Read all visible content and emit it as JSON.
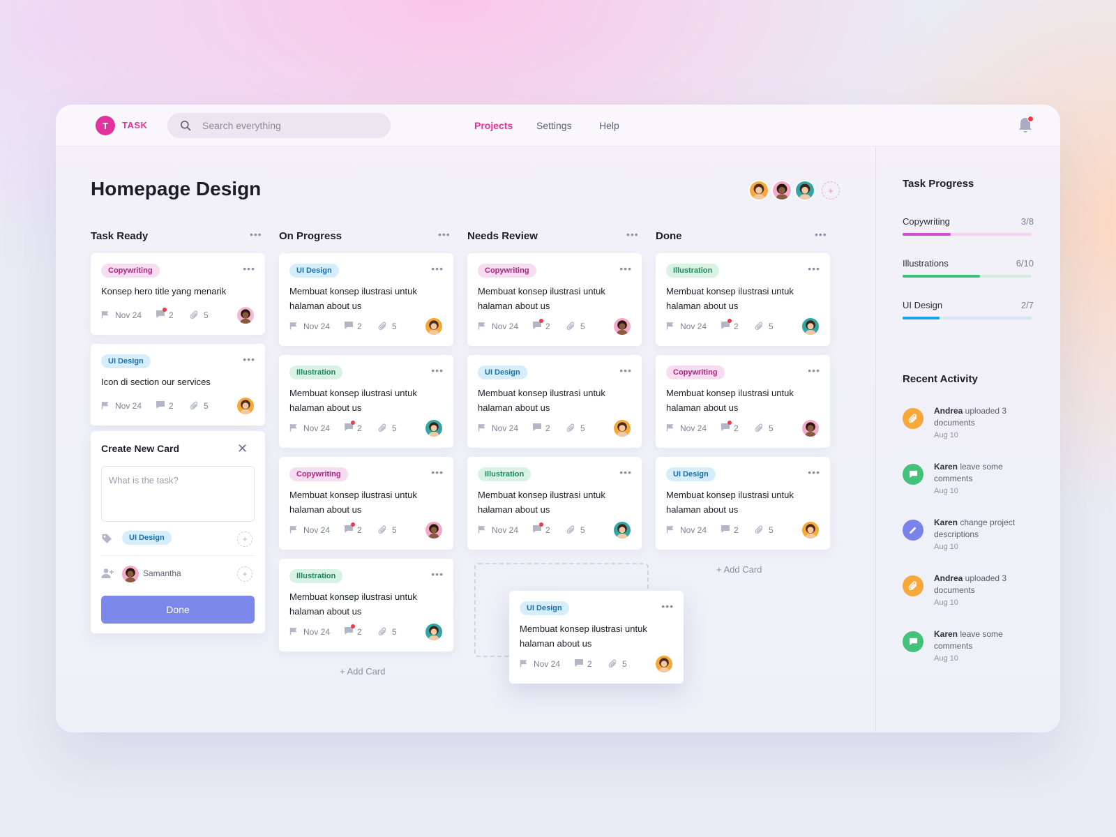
{
  "app": {
    "logo_letter": "T",
    "logo_text": "TASK"
  },
  "search": {
    "placeholder": "Search everything"
  },
  "nav": [
    {
      "label": "Projects",
      "active": true
    },
    {
      "label": "Settings"
    },
    {
      "label": "Help"
    }
  ],
  "page": {
    "title": "Homepage Design"
  },
  "board": {
    "add_card_label": "+ Add Card",
    "columns": [
      {
        "title": "Task Ready",
        "cards": [
          {
            "tag": "Copywriting",
            "title": "Konsep hero title yang menarik",
            "date": "Nov 24",
            "comments": "2",
            "attachments": "5",
            "unread": true,
            "avatar": "dark"
          },
          {
            "tag": "UI Design",
            "title": "Icon di section our services",
            "date": "Nov 24",
            "comments": "2",
            "attachments": "5",
            "unread": false,
            "avatar": "orange"
          }
        ]
      },
      {
        "title": "On Progress",
        "cards": [
          {
            "tag": "UI Design",
            "title": "Membuat konsep ilustrasi untuk halaman about us",
            "date": "Nov 24",
            "comments": "2",
            "attachments": "5",
            "unread": false,
            "avatar": "orange"
          },
          {
            "tag": "Illustration",
            "title": "Membuat konsep ilustrasi untuk halaman about us",
            "date": "Nov 24",
            "comments": "2",
            "attachments": "5",
            "unread": true,
            "avatar": "teal"
          },
          {
            "tag": "Copywriting",
            "title": "Membuat konsep ilustrasi untuk halaman about us",
            "date": "Nov 24",
            "comments": "2",
            "attachments": "5",
            "unread": true,
            "avatar": "pink"
          },
          {
            "tag": "Illustration",
            "title": "Membuat konsep ilustrasi untuk halaman about us",
            "date": "Nov 24",
            "comments": "2",
            "attachments": "5",
            "unread": true,
            "avatar": "teal"
          }
        ]
      },
      {
        "title": "Needs Review",
        "cards": [
          {
            "tag": "Copywriting",
            "title": "Membuat konsep ilustrasi untuk halaman about us",
            "date": "Nov 24",
            "comments": "2",
            "attachments": "5",
            "unread": true,
            "avatar": "pink"
          },
          {
            "tag": "UI Design",
            "title": "Membuat konsep ilustrasi untuk halaman about us",
            "date": "Nov 24",
            "comments": "2",
            "attachments": "5",
            "unread": false,
            "avatar": "orange"
          },
          {
            "tag": "Illustration",
            "title": "Membuat konsep ilustrasi untuk halaman about us",
            "date": "Nov 24",
            "comments": "2",
            "attachments": "5",
            "unread": true,
            "avatar": "teal"
          }
        ]
      },
      {
        "title": "Done",
        "cards": [
          {
            "tag": "Illustration",
            "title": "Membuat konsep ilustrasi untuk halaman about us",
            "date": "Nov 24",
            "comments": "2",
            "attachments": "5",
            "unread": true,
            "avatar": "teal"
          },
          {
            "tag": "Copywriting",
            "title": "Membuat konsep ilustrasi untuk halaman about us",
            "date": "Nov 24",
            "comments": "2",
            "attachments": "5",
            "unread": true,
            "avatar": "pink"
          },
          {
            "tag": "UI Design",
            "title": "Membuat konsep ilustrasi untuk halaman about us",
            "date": "Nov 24",
            "comments": "2",
            "attachments": "5",
            "unread": false,
            "avatar": "orange"
          }
        ]
      }
    ],
    "dragging_card": {
      "tag": "UI Design",
      "title": "Membuat konsep ilustrasi untuk halaman about us",
      "date": "Nov 24",
      "comments": "2",
      "attachments": "5",
      "unread": false,
      "avatar": "orange"
    }
  },
  "create_card": {
    "title": "Create New Card",
    "task_placeholder": "What is the task?",
    "tag": "UI Design",
    "assignee": "Samantha",
    "done_label": "Done"
  },
  "task_progress": {
    "title": "Task Progress",
    "items": [
      {
        "label": "Copywriting",
        "count": "3/8",
        "fraction": 0.375,
        "color": "#d24fd8",
        "track": "#f3d2ef"
      },
      {
        "label": "Illustrations",
        "count": "6/10",
        "fraction": 0.6,
        "color": "#3cbf78",
        "track": "#d5ebe1"
      },
      {
        "label": "UI Design",
        "count": "2/7",
        "fraction": 0.2857,
        "color": "#1ba1e8",
        "track": "#d3e6f3"
      }
    ]
  },
  "recent_activity": {
    "title": "Recent Activity",
    "items": [
      {
        "user": "Andrea",
        "text": " uploaded 3 documents",
        "date": "Aug 10",
        "icon": "paperclip-icon",
        "color": "#f7a83a"
      },
      {
        "user": "Karen",
        "text": " leave some comments",
        "date": "Aug 10",
        "icon": "comment-icon",
        "color": "#43c27a"
      },
      {
        "user": "Karen",
        "text": " change project descriptions",
        "date": "Aug 10",
        "icon": "pencil-icon",
        "color": "#7a83ea"
      },
      {
        "user": "Andrea",
        "text": " uploaded 3 documents",
        "date": "Aug 10",
        "icon": "paperclip-icon",
        "color": "#f7a83a"
      },
      {
        "user": "Karen",
        "text": " leave some comments",
        "date": "Aug 10",
        "icon": "comment-icon",
        "color": "#43c27a"
      }
    ]
  },
  "colors": {
    "accent": "#e0339c",
    "primary_button": "#7c88ea"
  }
}
